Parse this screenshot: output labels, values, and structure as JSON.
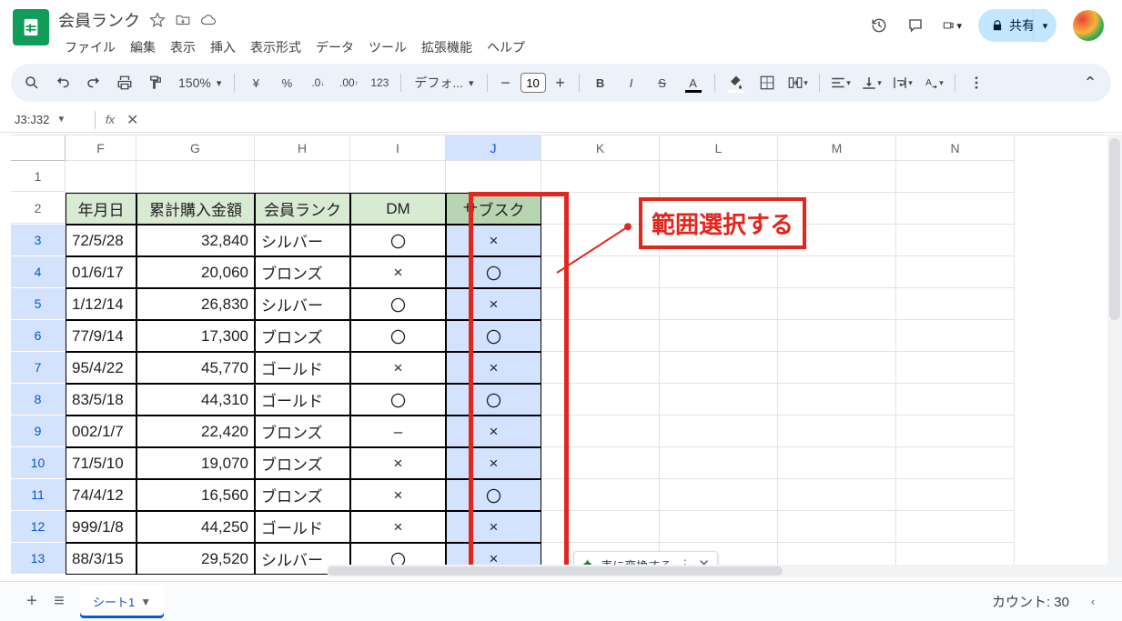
{
  "header": {
    "doc_title": "会員ランク",
    "menubar": [
      "ファイル",
      "編集",
      "表示",
      "挿入",
      "表示形式",
      "データ",
      "ツール",
      "拡張機能",
      "ヘルプ"
    ],
    "share_label": "共有"
  },
  "toolbar": {
    "zoom": "150%",
    "font_label": "デフォ...",
    "font_size": "10"
  },
  "fx": {
    "name_box": "J3:J32"
  },
  "grid": {
    "cols": [
      "F",
      "G",
      "H",
      "I",
      "J",
      "K",
      "L",
      "M",
      "N"
    ],
    "selected_col": "J",
    "header_row": {
      "F": "年月日",
      "G": "累計購入金額",
      "H": "会員ランク",
      "I": "DM",
      "J": "サブスク"
    },
    "rows": [
      {
        "n": 1
      },
      {
        "n": 2,
        "header": true
      },
      {
        "n": 3,
        "F": "72/5/28",
        "G": "32,840",
        "H": "シルバー",
        "I": "〇",
        "J": "×"
      },
      {
        "n": 4,
        "F": "01/6/17",
        "G": "20,060",
        "H": "ブロンズ",
        "I": "×",
        "J": "〇"
      },
      {
        "n": 5,
        "F": "1/12/14",
        "G": "26,830",
        "H": "シルバー",
        "I": "〇",
        "J": "×"
      },
      {
        "n": 6,
        "F": "77/9/14",
        "G": "17,300",
        "H": "ブロンズ",
        "I": "〇",
        "J": "〇"
      },
      {
        "n": 7,
        "F": "95/4/22",
        "G": "45,770",
        "H": "ゴールド",
        "I": "×",
        "J": "×"
      },
      {
        "n": 8,
        "F": "83/5/18",
        "G": "44,310",
        "H": "ゴールド",
        "I": "〇",
        "J": "〇"
      },
      {
        "n": 9,
        "F": "002/1/7",
        "G": "22,420",
        "H": "ブロンズ",
        "I": "–",
        "J": "×"
      },
      {
        "n": 10,
        "F": "71/5/10",
        "G": "19,070",
        "H": "ブロンズ",
        "I": "×",
        "J": "×"
      },
      {
        "n": 11,
        "F": "74/4/12",
        "G": "16,560",
        "H": "ブロンズ",
        "I": "×",
        "J": "〇"
      },
      {
        "n": 12,
        "F": "999/1/8",
        "G": "44,250",
        "H": "ゴールド",
        "I": "×",
        "J": "×"
      },
      {
        "n": 13,
        "F": "88/3/15",
        "G": "29,520",
        "H": "シルバー",
        "I": "〇",
        "J": "×"
      }
    ]
  },
  "annotation": {
    "text": "範囲選択する"
  },
  "chip": {
    "label": "表に変換する"
  },
  "sheetbar": {
    "tab_label": "シート1",
    "count_label": "カウント: 30"
  }
}
